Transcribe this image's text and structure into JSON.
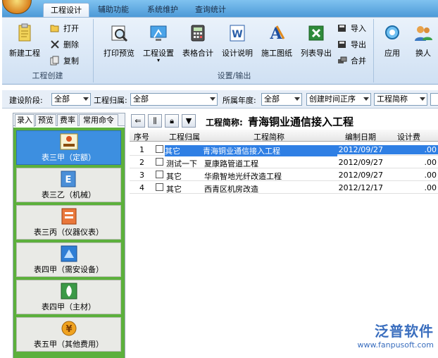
{
  "ribbon": {
    "tabs": [
      {
        "label": "工程设计",
        "active": true
      },
      {
        "label": "辅助功能",
        "active": false
      },
      {
        "label": "系统维护",
        "active": false
      },
      {
        "label": "查询统计",
        "active": false
      }
    ],
    "group_create": {
      "title": "工程创建",
      "new_label": "新建工程",
      "open_label": "打开",
      "delete_label": "删除",
      "copy_label": "复制"
    },
    "group_settings": {
      "title": "设置/输出",
      "print_preview_label": "打印预览",
      "project_settings_label": "工程设置",
      "table_total_label": "表格合计",
      "design_desc_label": "设计说明",
      "drawing_label": "施工图纸",
      "list_export_label": "列表导出",
      "import_label": "导入",
      "export_label": "导出",
      "merge_label": "合并"
    },
    "group_other": {
      "apply_label": "应用",
      "switch_user_label": "换人"
    }
  },
  "filters": {
    "stage_label": "建设阶段:",
    "stage_value": "全部",
    "owner_label": "工程归属:",
    "owner_value": "全部",
    "year_label": "所属年度:",
    "year_value": "全部",
    "sort_value": "创建时间正序",
    "field_value": "工程简称"
  },
  "left": {
    "tabs": [
      {
        "label": "录入",
        "active": true
      },
      {
        "label": "预览",
        "active": false
      },
      {
        "label": "费率",
        "active": false
      },
      {
        "label": "常用命令",
        "active": false
      }
    ],
    "items": [
      {
        "label": "表三甲（定额）",
        "icon": "quota-table-icon",
        "active": true
      },
      {
        "label": "表三乙（机械）",
        "icon": "machinery-table-icon",
        "active": false
      },
      {
        "label": "表三丙（仪器仪表）",
        "icon": "instrument-table-icon",
        "active": false
      },
      {
        "label": "表四甲（需安设备）",
        "icon": "equipment-table-icon",
        "active": false
      },
      {
        "label": "表四甲（主材）",
        "icon": "main-material-icon",
        "active": false
      },
      {
        "label": "表五甲（其他费用）",
        "icon": "other-costs-icon",
        "active": false
      }
    ]
  },
  "main": {
    "project_label": "工程简称:",
    "project_name": "青海铜业通信接入工程",
    "columns": {
      "index": "序号",
      "owner": "工程归属",
      "name": "工程简称",
      "date": "编制日期",
      "fee": "设计费"
    },
    "rows": [
      {
        "index": "1",
        "owner": "其它",
        "name": "青海铜业通信接入工程",
        "date": "2012/09/27",
        "fee": ".00",
        "selected": true
      },
      {
        "index": "2",
        "owner": "测试一下",
        "name": "夏康路管道工程",
        "date": "2012/09/27",
        "fee": ".00",
        "selected": false
      },
      {
        "index": "3",
        "owner": "其它",
        "name": "华鼎智地光纤改造工程",
        "date": "2012/09/27",
        "fee": ".00",
        "selected": false
      },
      {
        "index": "4",
        "owner": "其它",
        "name": "西青区机房改造",
        "date": "2012/12/17",
        "fee": ".00",
        "selected": false
      }
    ]
  },
  "watermark": {
    "brand": "泛普软件",
    "url": "www.fanpusoft.com"
  },
  "colors": {
    "accent": "#3d8fe0",
    "nav_bg": "#5cb03c",
    "selected_row": "#2f7fe4"
  }
}
